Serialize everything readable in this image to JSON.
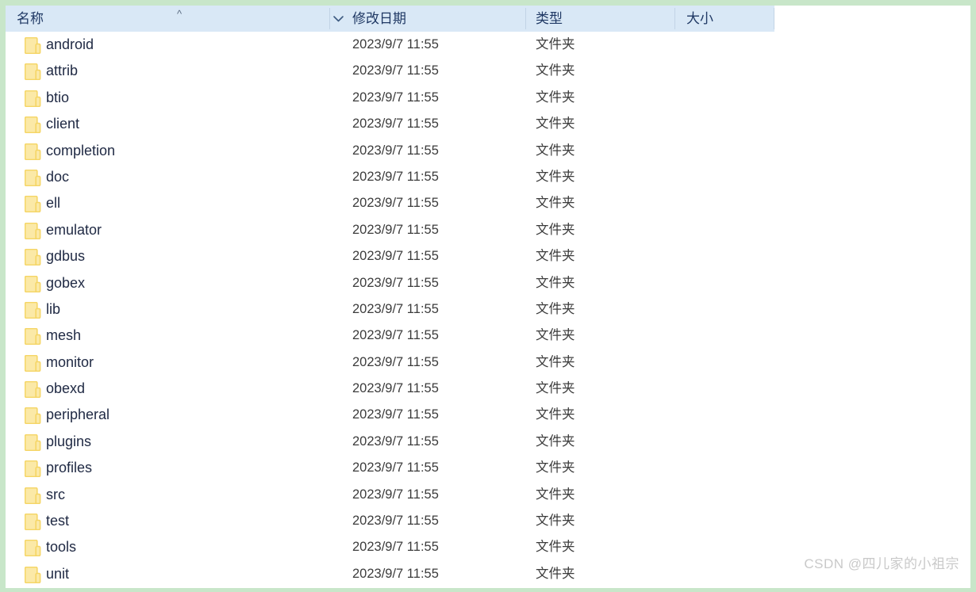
{
  "window": {
    "accent_header_bg": "#d9e8f6",
    "frame_border_color": "#c8e6c9",
    "folder_icon_color": "#f5d565"
  },
  "columns": {
    "name": {
      "label": "名称",
      "sort_indicator": "caret-up",
      "menu_indicator": "chevron-down"
    },
    "date": {
      "label": "修改日期"
    },
    "type": {
      "label": "类型"
    },
    "size": {
      "label": "大小"
    }
  },
  "files": [
    {
      "name": "android",
      "date": "2023/9/7 11:55",
      "type": "文件夹",
      "size": "",
      "icon": "folder-icon"
    },
    {
      "name": "attrib",
      "date": "2023/9/7 11:55",
      "type": "文件夹",
      "size": "",
      "icon": "folder-icon"
    },
    {
      "name": "btio",
      "date": "2023/9/7 11:55",
      "type": "文件夹",
      "size": "",
      "icon": "folder-icon"
    },
    {
      "name": "client",
      "date": "2023/9/7 11:55",
      "type": "文件夹",
      "size": "",
      "icon": "folder-icon"
    },
    {
      "name": "completion",
      "date": "2023/9/7 11:55",
      "type": "文件夹",
      "size": "",
      "icon": "folder-icon"
    },
    {
      "name": "doc",
      "date": "2023/9/7 11:55",
      "type": "文件夹",
      "size": "",
      "icon": "folder-icon"
    },
    {
      "name": "ell",
      "date": "2023/9/7 11:55",
      "type": "文件夹",
      "size": "",
      "icon": "folder-icon"
    },
    {
      "name": "emulator",
      "date": "2023/9/7 11:55",
      "type": "文件夹",
      "size": "",
      "icon": "folder-icon"
    },
    {
      "name": "gdbus",
      "date": "2023/9/7 11:55",
      "type": "文件夹",
      "size": "",
      "icon": "folder-icon"
    },
    {
      "name": "gobex",
      "date": "2023/9/7 11:55",
      "type": "文件夹",
      "size": "",
      "icon": "folder-icon"
    },
    {
      "name": "lib",
      "date": "2023/9/7 11:55",
      "type": "文件夹",
      "size": "",
      "icon": "folder-icon"
    },
    {
      "name": "mesh",
      "date": "2023/9/7 11:55",
      "type": "文件夹",
      "size": "",
      "icon": "folder-icon"
    },
    {
      "name": "monitor",
      "date": "2023/9/7 11:55",
      "type": "文件夹",
      "size": "",
      "icon": "folder-icon"
    },
    {
      "name": "obexd",
      "date": "2023/9/7 11:55",
      "type": "文件夹",
      "size": "",
      "icon": "folder-icon"
    },
    {
      "name": "peripheral",
      "date": "2023/9/7 11:55",
      "type": "文件夹",
      "size": "",
      "icon": "folder-icon"
    },
    {
      "name": "plugins",
      "date": "2023/9/7 11:55",
      "type": "文件夹",
      "size": "",
      "icon": "folder-icon"
    },
    {
      "name": "profiles",
      "date": "2023/9/7 11:55",
      "type": "文件夹",
      "size": "",
      "icon": "folder-icon"
    },
    {
      "name": "src",
      "date": "2023/9/7 11:55",
      "type": "文件夹",
      "size": "",
      "icon": "folder-icon"
    },
    {
      "name": "test",
      "date": "2023/9/7 11:55",
      "type": "文件夹",
      "size": "",
      "icon": "folder-icon"
    },
    {
      "name": "tools",
      "date": "2023/9/7 11:55",
      "type": "文件夹",
      "size": "",
      "icon": "folder-icon"
    },
    {
      "name": "unit",
      "date": "2023/9/7 11:55",
      "type": "文件夹",
      "size": "",
      "icon": "folder-icon"
    }
  ],
  "watermark": {
    "text": "CSDN @四儿家的小祖宗"
  }
}
